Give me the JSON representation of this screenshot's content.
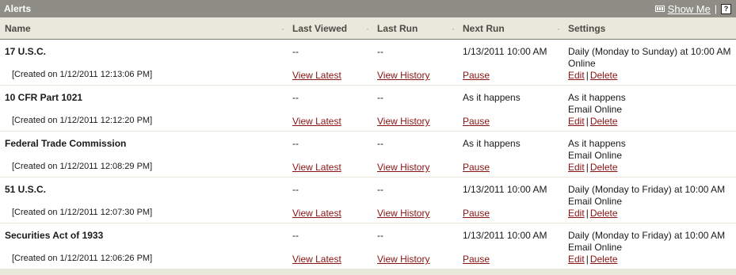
{
  "header": {
    "title": "Alerts",
    "show_me_label": "Show Me",
    "separator": "|",
    "help_glyph": "?",
    "icons": {
      "film": "film-icon",
      "help": "help-icon"
    }
  },
  "columns": {
    "name": "Name",
    "last_viewed": "Last Viewed",
    "last_run": "Last Run",
    "next_run": "Next Run",
    "settings": "Settings"
  },
  "link_labels": {
    "view_latest": "View Latest",
    "view_history": "View History",
    "pause": "Pause",
    "edit": "Edit",
    "delete": "Delete",
    "link_sep": "|"
  },
  "alerts": [
    {
      "name": "17 U.S.C.",
      "created": "[Created on 1/12/2011 12:13:06 PM]",
      "last_viewed": "--",
      "last_run": "--",
      "next_run": "1/13/2011 10:00 AM",
      "schedule": "Daily (Monday to Sunday) at 10:00 AM",
      "delivery": "Online"
    },
    {
      "name": "10 CFR Part 1021",
      "created": "[Created on 1/12/2011 12:12:20 PM]",
      "last_viewed": "--",
      "last_run": "--",
      "next_run": "As it happens",
      "schedule": "As it happens",
      "delivery": "Email Online"
    },
    {
      "name": "Federal Trade Commission",
      "created": "[Created on 1/12/2011 12:08:29 PM]",
      "last_viewed": "--",
      "last_run": "--",
      "next_run": "As it happens",
      "schedule": "As it happens",
      "delivery": "Email Online"
    },
    {
      "name": "51 U.S.C.",
      "created": "[Created on 1/12/2011 12:07:30 PM]",
      "last_viewed": "--",
      "last_run": "--",
      "next_run": "1/13/2011 10:00 AM",
      "schedule": "Daily (Monday to Friday) at 10:00 AM",
      "delivery": "Email Online"
    },
    {
      "name": "Securities Act of 1933",
      "created": "[Created on 1/12/2011 12:06:26 PM]",
      "last_viewed": "--",
      "last_run": "--",
      "next_run": "1/13/2011 10:00 AM",
      "schedule": "Daily (Monday to Friday) at 10:00 AM",
      "delivery": "Email Online"
    }
  ]
}
